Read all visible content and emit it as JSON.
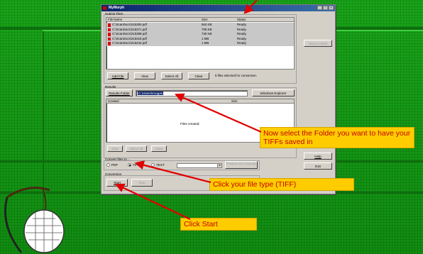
{
  "window": {
    "title": "MyMorph",
    "controls": [
      "_",
      "□",
      "×"
    ]
  },
  "submit_files": {
    "legend": "Submit Files",
    "columns": [
      "File Name",
      "Size",
      "Status"
    ],
    "rows": [
      {
        "name": "C:\\ScanDocs\\215383.pdf",
        "size": "562 KB",
        "status": "Ready."
      },
      {
        "name": "C:\\ScanDocs\\215371.pdf",
        "size": "706 KB",
        "status": "Ready."
      },
      {
        "name": "C:\\ScanDocs\\215388.pdf",
        "size": "726 KB",
        "status": "Ready."
      },
      {
        "name": "C:\\ScanDocs\\215318.pdf",
        "size": "1 MB",
        "status": "Ready."
      },
      {
        "name": "C:\\ScanDocs\\215442.pdf",
        "size": "1 MB",
        "status": "Ready."
      }
    ],
    "add_file": "Add File",
    "view": "View",
    "select_all": "Select All",
    "clear": "Clear",
    "summary": "5 files selected for conversion."
  },
  "status_detail": "Status Detail",
  "results": {
    "legend": "Results",
    "results_folder_button": "Results Folder",
    "folder_value": "C:\\Users\\Images",
    "windows_explorer": "Windows Explorer",
    "columns": [
      "Created",
      "Size"
    ],
    "empty_text": "Files created:",
    "view": "View",
    "select_all": "Select all",
    "clear": "Clear"
  },
  "convert": {
    "legend": "Convert files to ...",
    "options": [
      "PDF",
      "TIFF",
      "TEXT"
    ],
    "selected": "TIFF",
    "greyed_button": "Read/set and Language"
  },
  "conversion": {
    "legend": "Conversion",
    "start": "Start",
    "stop": "Stop"
  },
  "help": "Help",
  "exit": "Exit",
  "callouts": {
    "folder": "Now select the Folder you want to have your TIFFs saved in",
    "file_type": "Click your file type (TIFF)",
    "start": "Click Start"
  },
  "colors": {
    "callout_bg": "#ffcc00",
    "callout_text": "#c00000",
    "arrow": "#e00000",
    "slide_green": "#16a016"
  }
}
